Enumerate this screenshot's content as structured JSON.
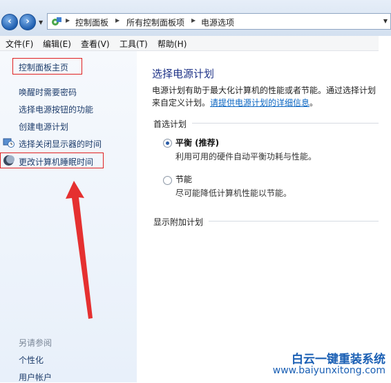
{
  "address_bar": {
    "breadcrumbs": [
      "控制面板",
      "所有控制面板项",
      "电源选项"
    ]
  },
  "menu": {
    "items": [
      "文件(F)",
      "编辑(E)",
      "查看(V)",
      "工具(T)",
      "帮助(H)"
    ]
  },
  "sidebar": {
    "home": "控制面板主页",
    "tasks": [
      "唤醒时需要密码",
      "选择电源按钮的功能",
      "创建电源计划",
      "选择关闭显示器的时间",
      "更改计算机睡眠时间"
    ],
    "see_also_title": "另请参阅",
    "see_also": [
      "个性化",
      "用户帐户"
    ]
  },
  "main": {
    "title": "选择电源计划",
    "desc_line1": "电源计划有助于最大化计算机的性能或者节能。通过选择计划",
    "desc_line2_prefix": "来自定义计划。",
    "desc_link": "请提供电源计划的详细信息",
    "desc_line2_suffix": "。",
    "preferred_title": "首选计划",
    "plans": [
      {
        "name": "平衡 (推荐)",
        "desc": "利用可用的硬件自动平衡功耗与性能。",
        "selected": true
      },
      {
        "name": "节能",
        "desc": "尽可能降低计算机性能以节能。",
        "selected": false
      }
    ],
    "additional_title": "显示附加计划"
  },
  "watermark": {
    "line1": "白云一键重装系统",
    "line2": "www.baiyunxitong.com"
  },
  "colors": {
    "highlight_box": "#e02020",
    "arrow": "#e53030",
    "link": "#0b66c2",
    "title": "#1e3287"
  }
}
